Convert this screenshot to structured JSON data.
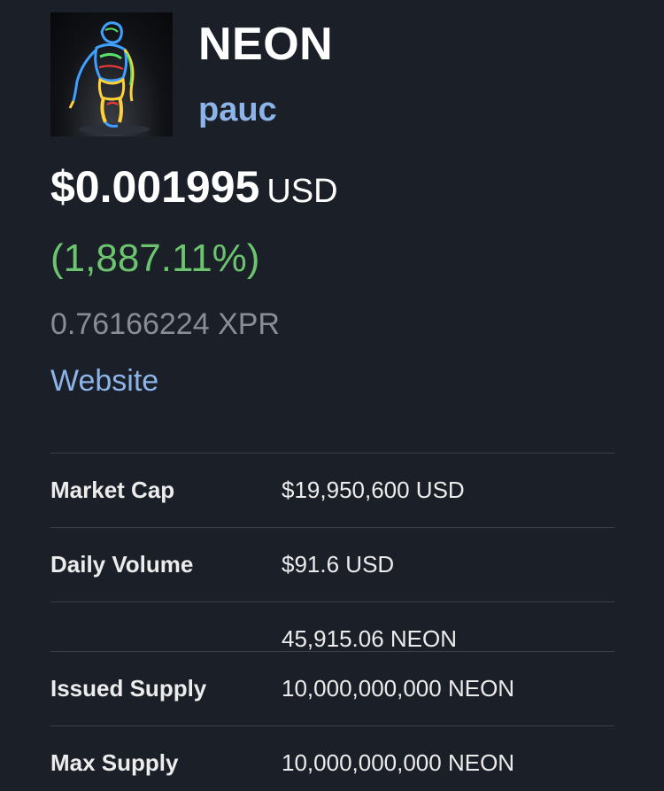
{
  "token": {
    "name": "NEON",
    "issuer": "pauc",
    "image_icon": "neon-figure-icon"
  },
  "price": {
    "value": "$0.001995",
    "unit": "USD",
    "change": "(1,887.11%)",
    "xpr_price": "0.76166224 XPR"
  },
  "links": {
    "website": "Website"
  },
  "stats": {
    "market_cap_label": "Market Cap",
    "market_cap_value": "$19,950,600 USD",
    "daily_volume_label": "Daily Volume",
    "daily_volume_value": "$91.6 USD",
    "daily_volume_token_value": "45,915.06 NEON",
    "issued_supply_label": "Issued Supply",
    "issued_supply_value": "10,000,000,000 NEON",
    "max_supply_label": "Max Supply",
    "max_supply_value": "10,000,000,000 NEON"
  },
  "colors": {
    "background": "#1b1f28",
    "accent_link": "#8cb4e8",
    "positive_change": "#6cc46e",
    "muted_text": "#8a8d93",
    "divider": "#3a3f4a"
  }
}
